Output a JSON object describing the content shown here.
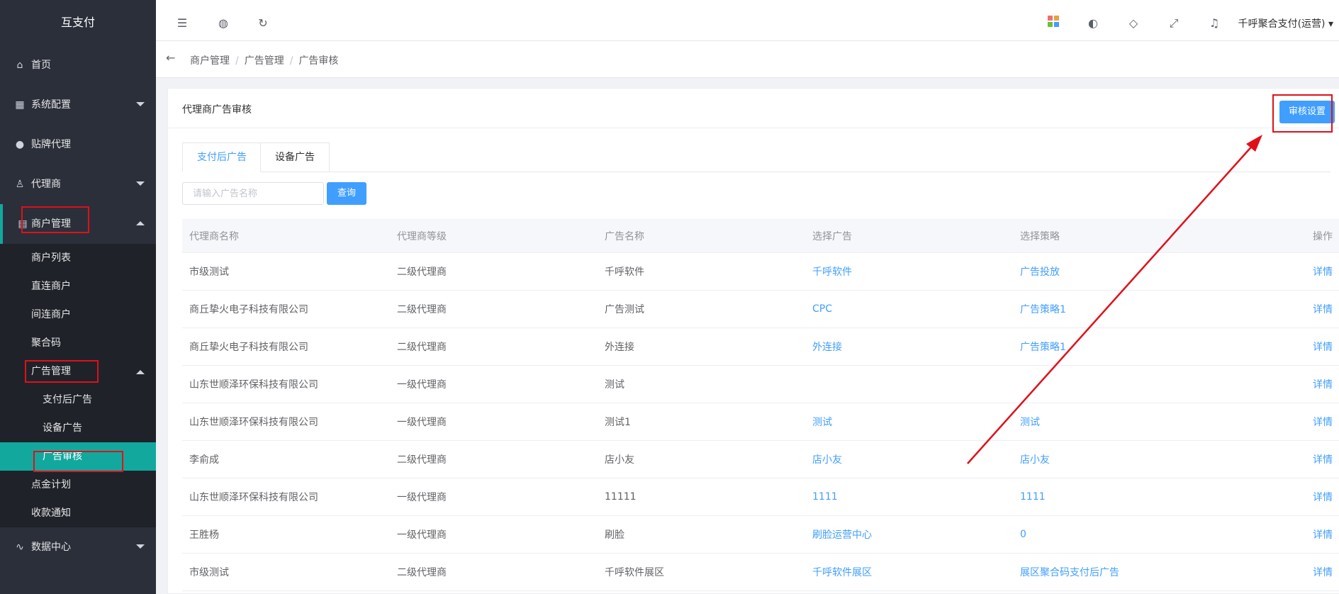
{
  "app": {
    "title": "互支付"
  },
  "sidebar": {
    "items": [
      {
        "label": "首页",
        "icon": "home-icon"
      },
      {
        "label": "系统配置",
        "icon": "config-icon"
      },
      {
        "label": "贴牌代理",
        "icon": "user-icon"
      },
      {
        "label": "代理商",
        "icon": "person-icon"
      },
      {
        "label": "商户管理",
        "icon": "grid-icon"
      }
    ],
    "merchant_sub": [
      "商户列表",
      "直连商户",
      "间连商户",
      "聚合码"
    ],
    "ad_group": {
      "label": "广告管理",
      "children": [
        "支付后广告",
        "设备广告",
        "广告审核"
      ]
    },
    "more_sub": [
      "点金计划",
      "收款通知"
    ],
    "data_center": "数据中心"
  },
  "header": {
    "user": "千呼聚合支付(运营)"
  },
  "breadcrumb": [
    "商户管理",
    "广告管理",
    "广告审核"
  ],
  "card": {
    "title": "代理商广告审核",
    "audit_button": "审核设置"
  },
  "tabs": [
    "支付后广告",
    "设备广告"
  ],
  "search": {
    "placeholder": "请输入广告名称",
    "button": "查询"
  },
  "table": {
    "columns": [
      "代理商名称",
      "代理商等级",
      "广告名称",
      "选择广告",
      "选择策略",
      "操作"
    ],
    "rows": [
      {
        "agent": "市级测试",
        "level": "二级代理商",
        "ad_name": "千呼软件",
        "ad": "千呼软件",
        "strategy": "广告投放",
        "action": "详情"
      },
      {
        "agent": "商丘挚火电子科技有限公司",
        "level": "二级代理商",
        "ad_name": "广告测试",
        "ad": "CPC",
        "strategy": "广告策略1",
        "action": "详情"
      },
      {
        "agent": "商丘挚火电子科技有限公司",
        "level": "二级代理商",
        "ad_name": "外连接",
        "ad": "外连接",
        "strategy": "广告策略1",
        "action": "详情"
      },
      {
        "agent": "山东世顺泽环保科技有限公司",
        "level": "一级代理商",
        "ad_name": "测试",
        "ad": "",
        "strategy": "",
        "action": "详情"
      },
      {
        "agent": "山东世顺泽环保科技有限公司",
        "level": "一级代理商",
        "ad_name": "测试1",
        "ad": "测试",
        "strategy": "测试",
        "action": "详情"
      },
      {
        "agent": "李俞成",
        "level": "二级代理商",
        "ad_name": "店小友",
        "ad": "店小友",
        "strategy": "店小友",
        "action": "详情"
      },
      {
        "agent": "山东世顺泽环保科技有限公司",
        "level": "一级代理商",
        "ad_name": "11111",
        "ad": "1111",
        "strategy": "1111",
        "action": "详情"
      },
      {
        "agent": "王胜杨",
        "level": "一级代理商",
        "ad_name": "刷脸",
        "ad": "刷脸运营中心",
        "strategy": "0",
        "action": "详情"
      },
      {
        "agent": "市级测试",
        "level": "二级代理商",
        "ad_name": "千呼软件展区",
        "ad": "千呼软件展区",
        "strategy": "展区聚合码支付后广告",
        "action": "详情"
      }
    ]
  },
  "colors": {
    "sidebar": "#2b2f3a",
    "accent": "#13a89e",
    "primary": "#409eff",
    "annotation": "#e0101a"
  }
}
